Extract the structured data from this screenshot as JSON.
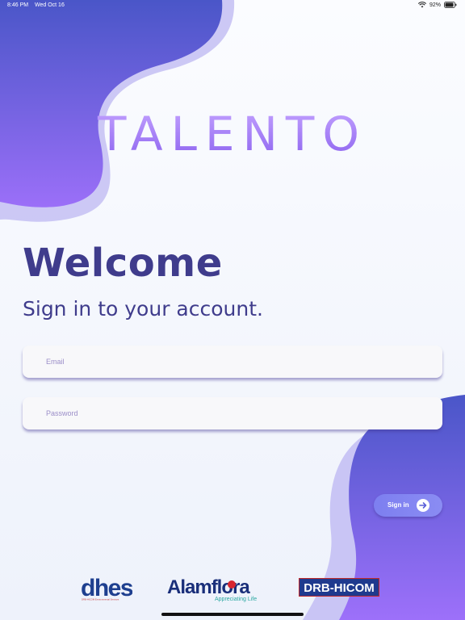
{
  "status_bar": {
    "time": "8:46 PM",
    "date": "Wed Oct 16",
    "battery": "92%",
    "battery_level": 0.92
  },
  "brand": {
    "app_name": "TALENTO"
  },
  "welcome": {
    "title": "Welcome",
    "subtitle": "Sign in to your account."
  },
  "form": {
    "email": {
      "placeholder": "Email",
      "value": ""
    },
    "password": {
      "placeholder": "Password",
      "value": ""
    },
    "sign_in_label": "Sign in"
  },
  "footer": {
    "logos": {
      "dhes": {
        "name": "dhes",
        "tagline": "DRB-HICOM Environmental Services"
      },
      "alamflora": {
        "name": "Alamflora",
        "tagline": "Appreciating Life"
      },
      "drb": {
        "name": "DRB-HICOM"
      }
    }
  },
  "colors": {
    "primary": "#3f3c8c",
    "accent": "#8a8cf3",
    "blob_dark": "#4754c6",
    "blob_light": "#9d6ff9",
    "placeholder": "#9b8ec8"
  },
  "icons": {
    "wifi": "wifi-icon",
    "battery": "battery-icon",
    "sign_in_arrow": "arrow-right-icon"
  }
}
